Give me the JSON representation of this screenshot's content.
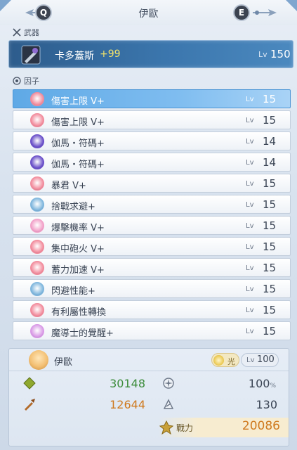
{
  "header": {
    "title": "伊歐",
    "prev_key": "Q",
    "next_key": "E"
  },
  "weapon_section": {
    "label": "武器",
    "name": "卡多蓋斯",
    "plus": "+99",
    "lv_label": "Lv",
    "lv_value": "150"
  },
  "factor_section": {
    "label": "因子",
    "items": [
      {
        "name": "傷害上限 V+",
        "lv_label": "Lv",
        "lv": "15",
        "icon": "lotus-icon",
        "color": "#f28b9c",
        "selected": true
      },
      {
        "name": "傷害上限 V+",
        "lv_label": "Lv",
        "lv": "15",
        "icon": "lotus-icon",
        "color": "#f28b9c"
      },
      {
        "name": "伽馬・符碼+",
        "lv_label": "Lv",
        "lv": "14",
        "icon": "gear-glyph-icon",
        "color": "#6a4fc9"
      },
      {
        "name": "伽馬・符碼+",
        "lv_label": "Lv",
        "lv": "14",
        "icon": "gear-glyph-icon",
        "color": "#6a4fc9"
      },
      {
        "name": "暴君 V+",
        "lv_label": "Lv",
        "lv": "15",
        "icon": "lotus-icon",
        "color": "#f28b9c"
      },
      {
        "name": "捨戰求避+",
        "lv_label": "Lv",
        "lv": "15",
        "icon": "shield-square-icon",
        "color": "#7fb6dd"
      },
      {
        "name": "爆擊機率 V+",
        "lv_label": "Lv",
        "lv": "15",
        "icon": "flower-ring-icon",
        "color": "#f2a0c8"
      },
      {
        "name": "集中砲火 V+",
        "lv_label": "Lv",
        "lv": "15",
        "icon": "lotus-icon",
        "color": "#f28b9c"
      },
      {
        "name": "蓄力加速 V+",
        "lv_label": "Lv",
        "lv": "15",
        "icon": "lotus-icon",
        "color": "#f28b9c"
      },
      {
        "name": "閃避性能+",
        "lv_label": "Lv",
        "lv": "15",
        "icon": "shield-square-icon",
        "color": "#7fb6dd"
      },
      {
        "name": "有利屬性轉換",
        "lv_label": "Lv",
        "lv": "15",
        "icon": "lotus-icon",
        "color": "#f28b9c"
      },
      {
        "name": "魔導士的覺醒+",
        "lv_label": "Lv",
        "lv": "15",
        "icon": "star-icon",
        "color": "#d99ae6"
      }
    ]
  },
  "character": {
    "name": "伊歐",
    "element": "光",
    "lv_label": "Lv",
    "lv_value": "100",
    "hp": "30148",
    "atk": "12644",
    "crit_pct": "100",
    "crit_unit": "%",
    "crit_dmg": "130",
    "power_label": "戰力",
    "power_value": "20086"
  }
}
